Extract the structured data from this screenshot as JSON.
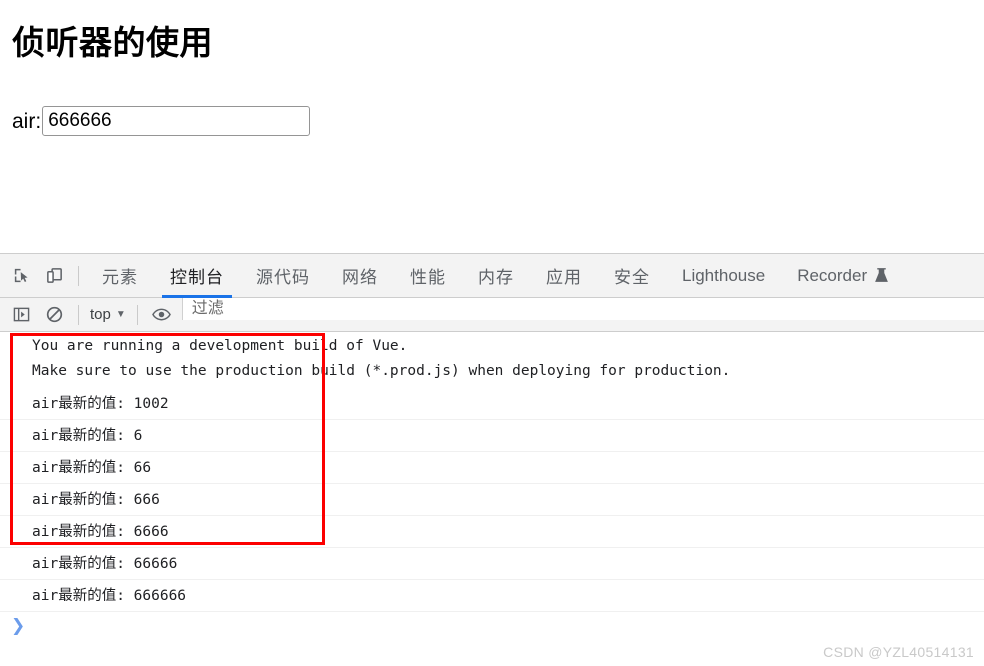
{
  "page": {
    "title": "侦听器的使用",
    "field": {
      "label": "air:",
      "value": "666666",
      "placeholder": ""
    }
  },
  "devtools": {
    "toolbar_icons": [
      {
        "name": "inspect-element-icon",
        "glyph": "inspect"
      },
      {
        "name": "device-toolbar-icon",
        "glyph": "device"
      }
    ],
    "tabs": [
      {
        "label": "元素",
        "active": false,
        "cjk": true
      },
      {
        "label": "控制台",
        "active": true,
        "cjk": true
      },
      {
        "label": "源代码",
        "active": false,
        "cjk": true
      },
      {
        "label": "网络",
        "active": false,
        "cjk": true
      },
      {
        "label": "性能",
        "active": false,
        "cjk": true
      },
      {
        "label": "内存",
        "active": false,
        "cjk": true
      },
      {
        "label": "应用",
        "active": false,
        "cjk": true
      },
      {
        "label": "安全",
        "active": false,
        "cjk": true
      },
      {
        "label": "Lighthouse",
        "active": false,
        "cjk": false
      },
      {
        "label": "Recorder",
        "active": false,
        "cjk": false,
        "badge": "flask-icon"
      }
    ],
    "active_tab": "控制台",
    "accent_color": "#1a73e8",
    "console_toolbar": {
      "sidebar_toggle": "console-sidebar-icon",
      "clear_console": "clear-console-icon",
      "context": "top",
      "context_caret": "▼",
      "eye_icon": "live-expression-eye-icon",
      "filter_placeholder": "过滤",
      "filter_value": ""
    },
    "console": {
      "banner": [
        "You are running a development build of Vue.",
        "Make sure to use the production build (*.prod.js) when deploying for production."
      ],
      "logs": [
        "air最新的值: 1002",
        "air最新的值: 6",
        "air最新的值: 66",
        "air最新的值: 666",
        "air最新的值: 6666",
        "air最新的值: 66666",
        "air最新的值: 666666"
      ],
      "prompt_symbol": "❯",
      "highlight_color": "#fc0000"
    }
  },
  "watermark": "CSDN @YZL40514131"
}
